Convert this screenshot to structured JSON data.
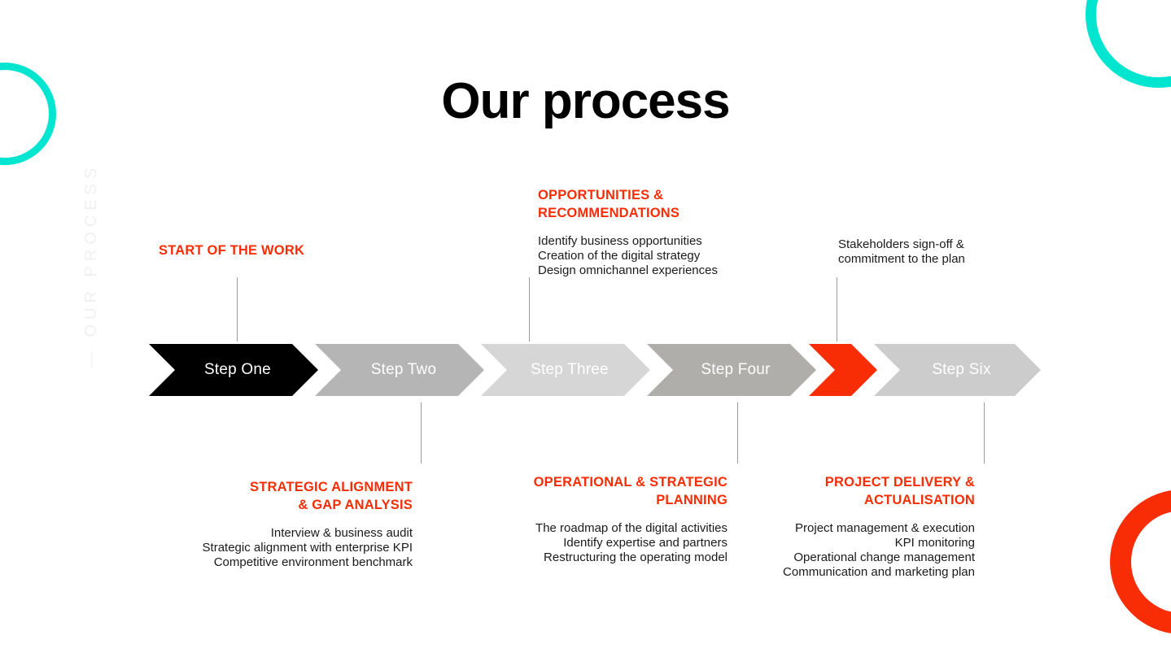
{
  "slide": {
    "title": "Our process",
    "side_label": "— OUR PROCESS",
    "background_color": "#ffffff"
  },
  "colors": {
    "accent_red": "#f92d05",
    "accent_cyan": "#00e5d0",
    "black": "#000000",
    "gray_mid": "#b5b5b5",
    "gray_light": "#d6d6d6",
    "gray_medium_dark": "#b0aeab",
    "connector": "#9a9a9a",
    "side_label": "#f0f0f0"
  },
  "decorations": [
    {
      "name": "ring-left",
      "color": "#00e5d0"
    },
    {
      "name": "ring-topright",
      "color": "#00e5d0"
    },
    {
      "name": "ring-bottomright",
      "color": "#f92d05"
    }
  ],
  "steps": [
    {
      "label": "Step One",
      "fill": "#000000",
      "text_color": "#ffffff"
    },
    {
      "label": "Step Two",
      "fill": "#b5b5b5",
      "text_color": "#ffffff"
    },
    {
      "label": "Step Three",
      "fill": "#d6d6d6",
      "text_color": "#ffffff"
    },
    {
      "label": "Step Four",
      "fill": "#b0aeab",
      "text_color": "#ffffff"
    },
    {
      "label": "",
      "fill": "#f92d05",
      "text_color": "#ffffff"
    },
    {
      "label": "Step Six",
      "fill": "#cccccc",
      "text_color": "#ffffff"
    }
  ],
  "callouts": {
    "above": [
      {
        "heading": "START OF THE WORK",
        "lines": [],
        "align": "left"
      },
      {
        "heading": "OPPORTUNITIES &\nRECOMMENDATIONS",
        "heading_line_1": "OPPORTUNITIES &",
        "heading_line_2": "RECOMMENDATIONS",
        "lines": [
          "Identify business opportunities",
          "Creation of the digital strategy",
          "Design omnichannel experiences"
        ],
        "align": "left"
      },
      {
        "heading": "",
        "lines": [
          "Stakeholders sign-off &",
          "commitment to the plan"
        ],
        "align": "left"
      }
    ],
    "below": [
      {
        "heading_line_1": "STRATEGIC ALIGNMENT",
        "heading_line_2": "& GAP ANALYSIS",
        "lines": [
          "Interview & business audit",
          "Strategic alignment with enterprise KPI",
          "Competitive environment benchmark"
        ],
        "align": "right"
      },
      {
        "heading_line_1": "OPERATIONAL & STRATEGIC",
        "heading_line_2": "PLANNING",
        "lines": [
          "The roadmap of the digital activities",
          "Identify expertise and partners",
          "Restructuring the operating model"
        ],
        "align": "right"
      },
      {
        "heading_line_1": "PROJECT DELIVERY &",
        "heading_line_2": "ACTUALISATION",
        "lines": [
          "Project management & execution",
          "KPI monitoring",
          "Operational change management",
          "Communication and marketing plan"
        ],
        "align": "right"
      }
    ]
  }
}
